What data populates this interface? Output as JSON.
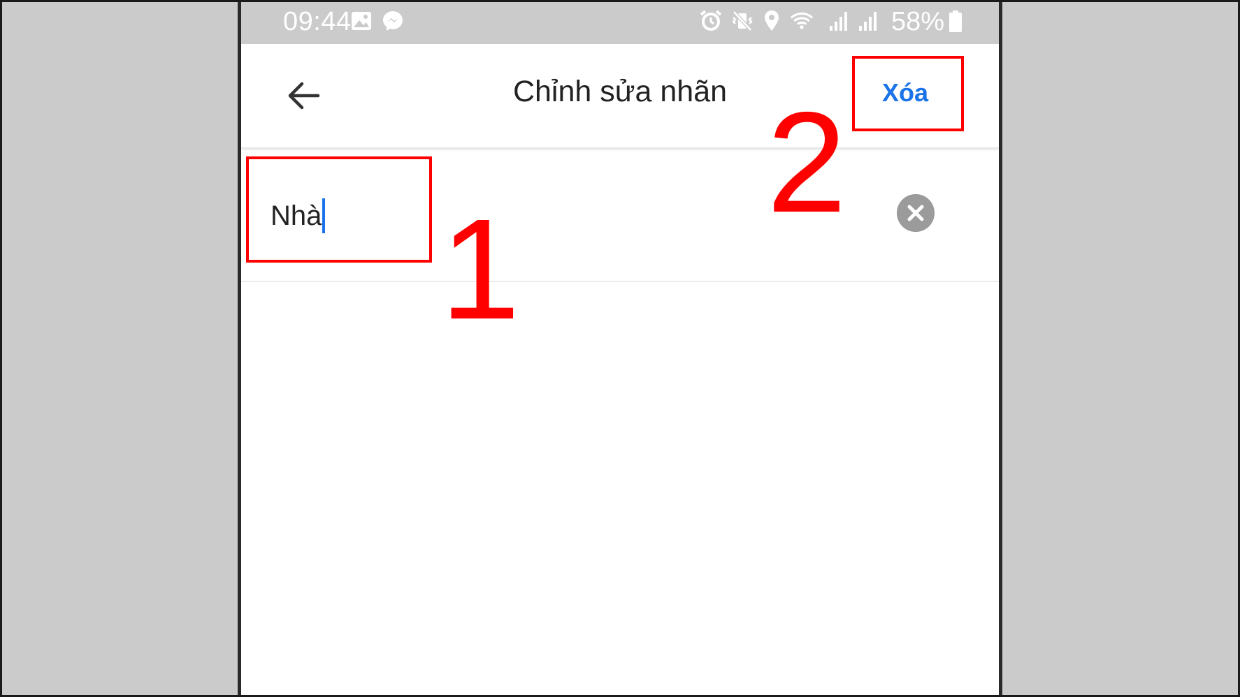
{
  "status_bar": {
    "time": "09:44",
    "battery": "58%",
    "icons": [
      "gallery-icon",
      "messenger-icon",
      "alarm-icon",
      "mute-vibrate-icon",
      "location-icon",
      "wifi-icon",
      "signal-icon",
      "signal-icon-2",
      "battery-icon"
    ]
  },
  "app_bar": {
    "title": "Chỉnh sửa nhãn",
    "delete_label": "Xóa",
    "back_icon": "arrow-back-icon"
  },
  "label_field": {
    "value": "Nhà",
    "clear_icon": "clear-circle-icon"
  },
  "annotations": {
    "step1": "1",
    "step2": "2"
  },
  "colors": {
    "accent": "#1a73e8",
    "annotation": "#ff0000",
    "statusbar_bg": "#cbcbcb"
  }
}
